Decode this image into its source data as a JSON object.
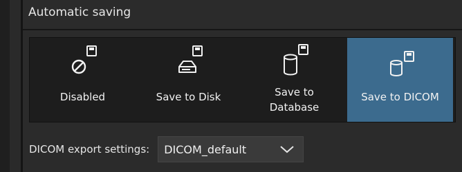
{
  "section": {
    "title": "Automatic saving"
  },
  "options": [
    {
      "label": "Disabled",
      "icon": "disabled-icon",
      "selected": false
    },
    {
      "label": "Save to Disk",
      "icon": "disk-icon",
      "selected": false
    },
    {
      "label": "Save to\nDatabase",
      "icon": "database-icon",
      "selected": false
    },
    {
      "label": "Save to DICOM",
      "icon": "dicom-database-icon",
      "selected": true
    }
  ],
  "export": {
    "label": "DICOM export settings:",
    "selected_value": "DICOM_default"
  },
  "colors": {
    "selected_background": "#3c6b8e",
    "panel_background": "#2b2b2b",
    "options_background": "#1d1d1d"
  }
}
